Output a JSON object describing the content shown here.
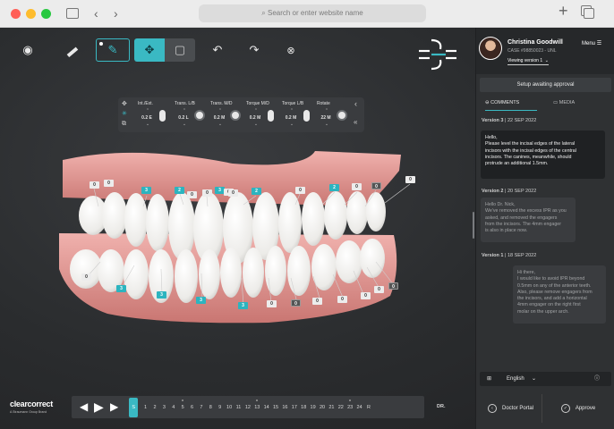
{
  "browser": {
    "url_placeholder": "Search or enter website name",
    "traffic_colors": [
      "#ff5f57",
      "#febc2e",
      "#28c840"
    ]
  },
  "toolbar": {
    "tools": [
      "eye",
      "ruler",
      "pencil",
      "move",
      "lock"
    ],
    "undo": "undo",
    "redo": "redo",
    "reset": "reset"
  },
  "user": {
    "name": "Christina Goodwill",
    "case": "CASE #98850023 - UNL",
    "version_select": "Viewing version 1",
    "menu_label": "Menu"
  },
  "sidebar": {
    "status": "Setup awaiting approval",
    "tabs": {
      "comments": "COMMENTS",
      "media": "MEDIA"
    },
    "messages": [
      {
        "version": "Version 3",
        "date": "22 SEP 2022",
        "lines": [
          "Hello,",
          "Please level the incisal edges of the lateral",
          "incisors with the incisal edges of the central",
          "incisors. The canines, meanwhile, should",
          "protrude an additional 1.5mm."
        ]
      },
      {
        "version": "Version 2",
        "date": "20 SEP 2022",
        "lines": [
          "Hello Dr. Nick,",
          "We've removed the excess IPR as you",
          "asked, and removed the engagers",
          "from the incisors. The 4mm engager",
          "is also in place now."
        ]
      },
      {
        "version": "Version 1",
        "date": "18 SEP 2022",
        "lines": [
          "Hi there,",
          "I would like to avoid IPR beyond",
          "0.5mm on any of the anterior teeth.",
          "Also, please remove engagers from",
          "the incisors, and add a horizontal",
          "4mm engager on the right first",
          "molar on the upper arch."
        ]
      }
    ],
    "language": "English",
    "doctor_portal": "Doctor Portal",
    "approve": "Approve"
  },
  "controls": [
    {
      "label": "Int./Ext.",
      "value": "0.2 E",
      "widget": "slider"
    },
    {
      "label": "Trans. L/B",
      "value": "0.2 L",
      "widget": "dial"
    },
    {
      "label": "Trans. M/D",
      "value": "0.2 M",
      "widget": "dial"
    },
    {
      "label": "Torque M/D",
      "value": "0.2 M",
      "widget": "slider"
    },
    {
      "label": "Torque L/B",
      "value": "0.2 M",
      "widget": "slider"
    },
    {
      "label": "Rotate",
      "value": "22 M",
      "widget": "dial"
    }
  ],
  "timeline": {
    "frames": [
      "S",
      "1",
      "2",
      "3",
      "4",
      "5",
      "6",
      "7",
      "8",
      "9",
      "10",
      "11",
      "12",
      "13",
      "14",
      "15",
      "16",
      "17",
      "18",
      "19",
      "20",
      "21",
      "22",
      "23",
      "24",
      "R"
    ],
    "dotted_frames": [
      "5",
      "13",
      "23"
    ],
    "active": "S",
    "dr_label": "DR."
  },
  "tooth_tags": [
    {
      "t": "0",
      "s": "w"
    },
    {
      "t": "3",
      "s": "t"
    },
    {
      "t": "2",
      "s": "t"
    },
    {
      "t": "0",
      "s": "w"
    },
    {
      "t": "3",
      "s": "t"
    },
    {
      "t": "2",
      "s": "t"
    },
    {
      "t": "0",
      "s": "w"
    },
    {
      "t": "0",
      "s": "w"
    },
    {
      "t": "2",
      "s": "t"
    },
    {
      "t": "0",
      "s": "w"
    },
    {
      "t": "0",
      "s": "g"
    },
    {
      "t": "0",
      "s": "w"
    },
    {
      "t": "0",
      "s": "w"
    },
    {
      "t": "0",
      "s": "w"
    },
    {
      "t": "0",
      "s": "w"
    },
    {
      "t": "0",
      "s": "w"
    },
    {
      "t": "3",
      "s": "t"
    },
    {
      "t": "3",
      "s": "t"
    },
    {
      "t": "3",
      "s": "t"
    },
    {
      "t": "3",
      "s": "t"
    },
    {
      "t": "0",
      "s": "w"
    },
    {
      "t": "0",
      "s": "w"
    },
    {
      "t": "0",
      "s": "g"
    },
    {
      "t": "0",
      "s": "g"
    },
    {
      "t": "0",
      "s": "w"
    },
    {
      "t": "0",
      "s": "w"
    },
    {
      "t": "0",
      "s": "w"
    }
  ],
  "brand": {
    "logo": "clearcorrect",
    "sub": "A Straumann Group Brand"
  },
  "colors": {
    "accent": "#3ab9c3",
    "gum": "#e89e9a",
    "tooth": "#f4f4f2"
  }
}
